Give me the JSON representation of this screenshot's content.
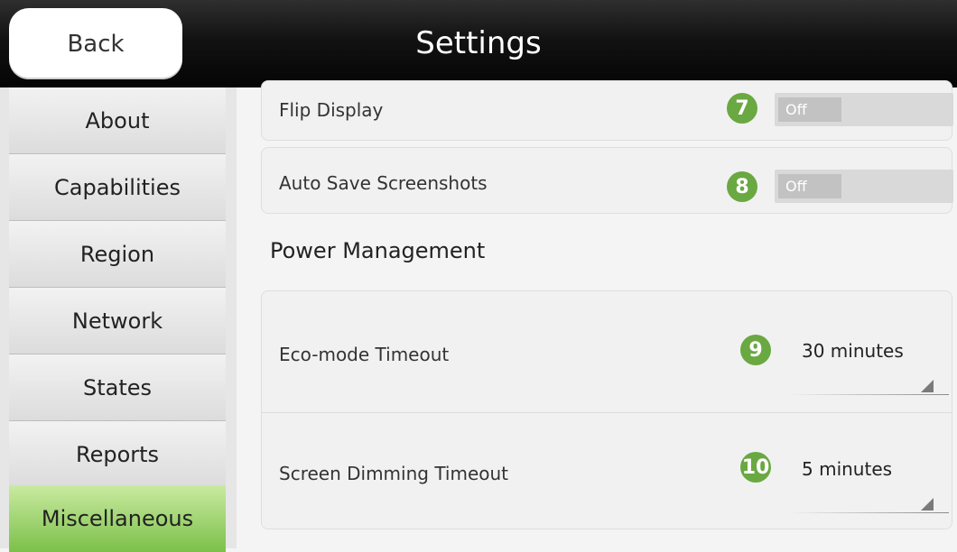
{
  "header": {
    "back_label": "Back",
    "title": "Settings"
  },
  "sidebar": {
    "items": [
      {
        "label": "About",
        "active": false
      },
      {
        "label": "Capabilities",
        "active": false
      },
      {
        "label": "Region",
        "active": false
      },
      {
        "label": "Network",
        "active": false
      },
      {
        "label": "States",
        "active": false
      },
      {
        "label": "Reports",
        "active": false
      },
      {
        "label": "Miscellaneous",
        "active": true
      }
    ]
  },
  "settings": {
    "flip_display": {
      "label": "Flip Display",
      "toggle": "Off",
      "badge": "7"
    },
    "auto_save": {
      "label": "Auto Save Screenshots",
      "toggle": "Off",
      "badge": "8"
    },
    "power_section_title": "Power Management",
    "eco_mode": {
      "label": "Eco-mode Timeout",
      "value": "30 minutes",
      "badge": "9"
    },
    "screen_dimming": {
      "label": "Screen Dimming Timeout",
      "value": "5 minutes",
      "badge": "10"
    }
  },
  "colors": {
    "accent_green": "#7cc04a",
    "badge_green": "#6aa842",
    "header_black": "#050505"
  }
}
